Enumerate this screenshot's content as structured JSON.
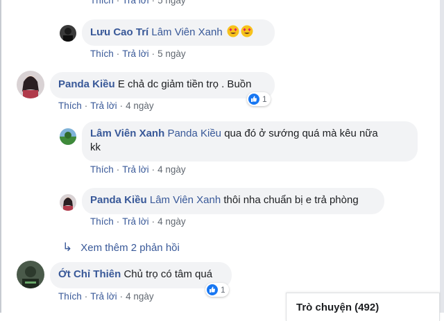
{
  "top_partial": {
    "like": "Thích",
    "reply": "Trả lời",
    "time": "5 ngày"
  },
  "comments": [
    {
      "author": "Lưu Cao Trí",
      "mention": "Lâm Viên Xanh",
      "text": "",
      "emojis": [
        "heart-eyes-emoji",
        "heart-eyes-emoji"
      ],
      "like": "Thích",
      "reply": "Trả lời",
      "time": "5 ngày"
    },
    {
      "author": "Panda Kiều",
      "mention": "",
      "text": "E chả dc giảm tiền trọ . Buồn",
      "reaction_count": "1",
      "like": "Thích",
      "reply": "Trả lời",
      "time": "4 ngày"
    },
    {
      "author": "Lâm Viên Xanh",
      "mention": "Panda Kiều",
      "text": "qua đó ở sướng quá mà kêu nữa",
      "text_line2": "kk",
      "like": "Thích",
      "reply": "Trả lời",
      "time": "4 ngày"
    },
    {
      "author": "Panda Kiều",
      "mention": "Lâm Viên Xanh",
      "text": "thôi nha chuẩn bị e trả phòng",
      "like": "Thích",
      "reply": "Trả lời",
      "time": "4 ngày"
    },
    {
      "author": "Ớt Chỉ Thiên",
      "mention": "",
      "text": "Chủ trọ có tâm quá",
      "reaction_count": "1",
      "like": "Thích",
      "reply": "Trả lời",
      "time": "4 ngày"
    }
  ],
  "more_replies": {
    "label": "Xem thêm 2 phản hồi",
    "icon": "reply-arrow-icon"
  },
  "chat": {
    "label": "Trò chuyện (492)"
  },
  "colors": {
    "link": "#385898",
    "bubble": "#f2f3f5",
    "like_blue": "#1877f2",
    "meta_gray": "#606770"
  }
}
